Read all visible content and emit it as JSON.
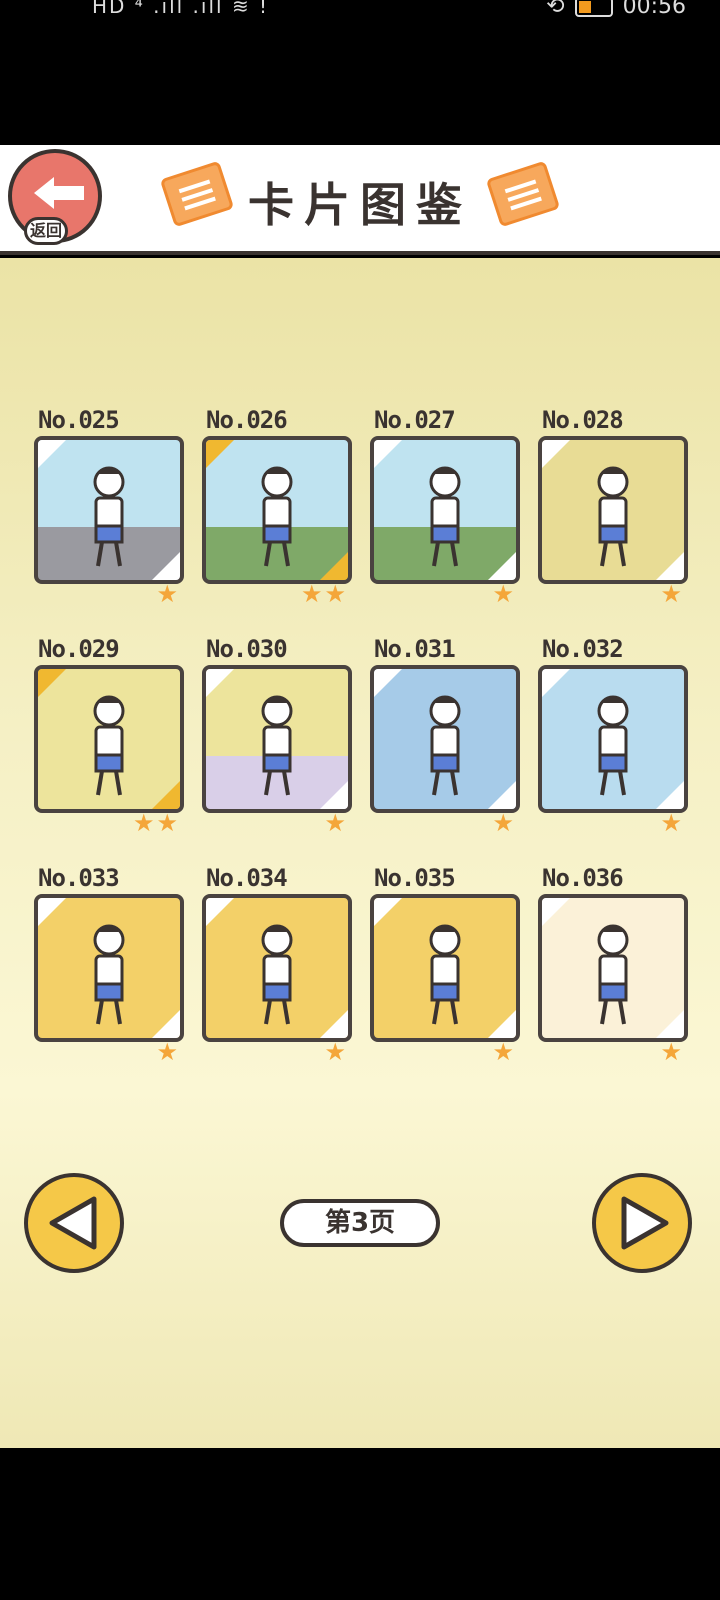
{
  "status_bar": {
    "left_icons": "HD ⁴ .ıll .ıll ≋ !",
    "time": "00:56"
  },
  "header": {
    "title": "卡片图鉴",
    "back_label": "返回"
  },
  "cards": [
    {
      "num": "No.025",
      "stars": "★",
      "tl_gold": false,
      "br_gold": false,
      "bg": "#bfe3f0",
      "ground": "#9a9aa0"
    },
    {
      "num": "No.026",
      "stars": "★★",
      "tl_gold": true,
      "br_gold": true,
      "bg": "#bfe3f0",
      "ground": "#7fa968"
    },
    {
      "num": "No.027",
      "stars": "★",
      "tl_gold": false,
      "br_gold": false,
      "bg": "#bfe3f0",
      "ground": "#7fa968"
    },
    {
      "num": "No.028",
      "stars": "★",
      "tl_gold": false,
      "br_gold": false,
      "bg": "#e8dc95",
      "ground": "#e8dc95"
    },
    {
      "num": "No.029",
      "stars": "★★",
      "tl_gold": true,
      "br_gold": true,
      "bg": "#ede49c",
      "ground": "#ede49c"
    },
    {
      "num": "No.030",
      "stars": "★",
      "tl_gold": false,
      "br_gold": false,
      "bg": "#ede49c",
      "ground": "#d9cfe8"
    },
    {
      "num": "No.031",
      "stars": "★",
      "tl_gold": false,
      "br_gold": false,
      "bg": "#a6cbe8",
      "ground": "#a6cbe8"
    },
    {
      "num": "No.032",
      "stars": "★",
      "tl_gold": false,
      "br_gold": false,
      "bg": "#b9dcef",
      "ground": "#b9dcef"
    },
    {
      "num": "No.033",
      "stars": "★",
      "tl_gold": false,
      "br_gold": false,
      "bg": "#f3d068",
      "ground": "#f3d068"
    },
    {
      "num": "No.034",
      "stars": "★",
      "tl_gold": false,
      "br_gold": false,
      "bg": "#f3d068",
      "ground": "#f3d068"
    },
    {
      "num": "No.035",
      "stars": "★",
      "tl_gold": false,
      "br_gold": false,
      "bg": "#f3d068",
      "ground": "#f3d068"
    },
    {
      "num": "No.036",
      "stars": "★",
      "tl_gold": false,
      "br_gold": false,
      "bg": "#fbf1d8",
      "ground": "#fbf1d8"
    }
  ],
  "pagination": {
    "page_label": "第3页"
  },
  "colors": {
    "accent_orange": "#f4a63a",
    "button_yellow": "#f5c848",
    "back_red": "#e8766b",
    "outline": "#3a3330"
  }
}
